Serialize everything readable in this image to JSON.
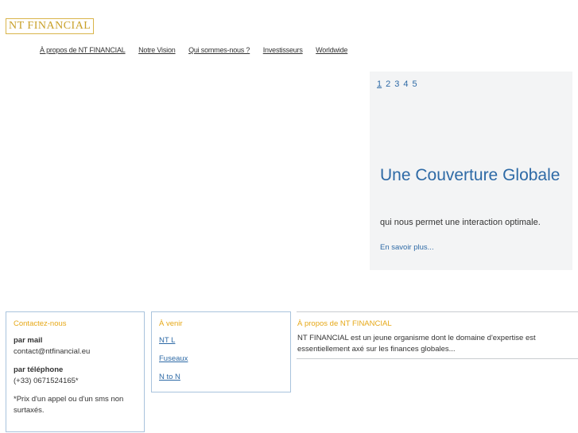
{
  "header": {
    "logo": "NT FINANCIAL"
  },
  "nav": {
    "items": [
      "À propos de NT FINANCIAL",
      "Notre Vision",
      "Qui sommes-nous ?",
      "Investisseurs",
      "Worldwide"
    ]
  },
  "hero": {
    "pages": [
      "1",
      "2",
      "3",
      "4",
      "5"
    ],
    "current_page": "1",
    "title": "Une Couverture Globale",
    "subtitle": "qui nous permet une interaction optimale.",
    "more_link": "En savoir plus..."
  },
  "contact": {
    "title": "Contactez-nous",
    "mail_label": "par mail",
    "mail_value": "contact@ntfinancial.eu",
    "phone_label": "par téléphone",
    "phone_value": "(+33) 0671524165*",
    "note": "*Prix d'un appel ou d'un sms non surtaxés."
  },
  "upcoming": {
    "title": "À venir",
    "links": [
      "NT L",
      "Fuseaux",
      "N to N"
    ]
  },
  "about": {
    "title": "À propos de NT FINANCIAL",
    "text": "NT FINANCIAL est un jeune organisme dont le domaine d'expertise est essentiellement axé sur les finances globales..."
  },
  "colors": {
    "accent_gold": "#c9a028",
    "link_blue": "#2e6aa6",
    "hero_bg": "#f3f4f5"
  }
}
